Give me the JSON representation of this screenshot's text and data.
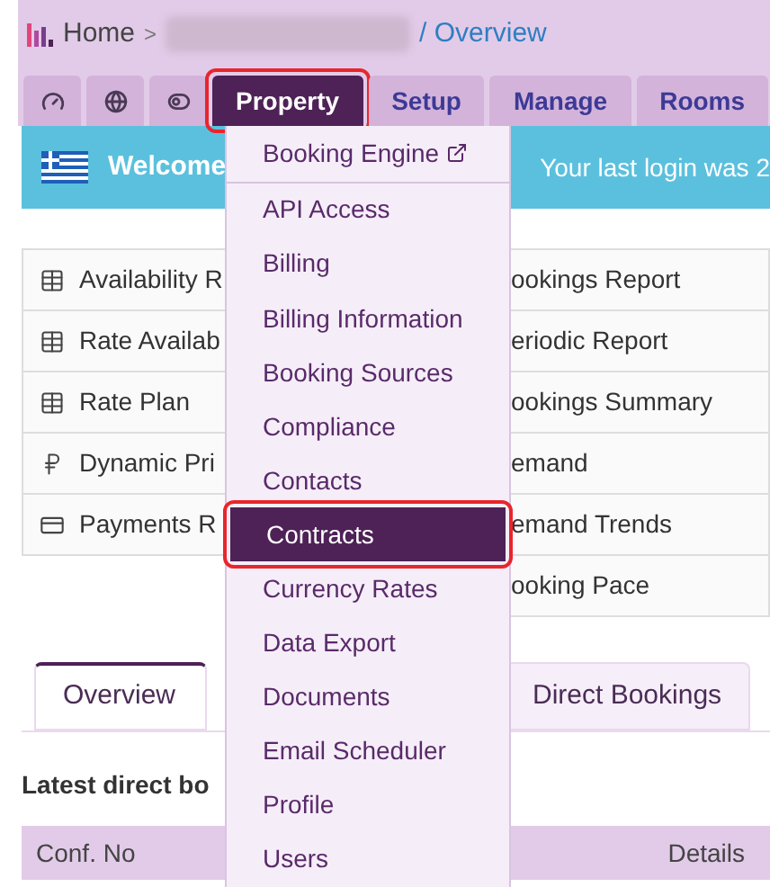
{
  "breadcrumb": {
    "home": "Home",
    "separator": ">",
    "current": "/ Overview"
  },
  "nav_tabs": [
    {
      "kind": "gauge",
      "selected": false,
      "highlighted": false
    },
    {
      "kind": "globe",
      "selected": false,
      "highlighted": false
    },
    {
      "kind": "toggle",
      "selected": false,
      "highlighted": false
    },
    {
      "kind": "text",
      "label": "Property",
      "selected": true,
      "highlighted": true
    },
    {
      "kind": "text",
      "label": "Setup",
      "selected": false,
      "highlighted": false
    },
    {
      "kind": "text",
      "label": "Manage",
      "selected": false,
      "highlighted": false
    },
    {
      "kind": "text",
      "label": "Rooms",
      "selected": false,
      "highlighted": false
    }
  ],
  "banner": {
    "greeting": "Welcome",
    "last_login": "Your last login was 2"
  },
  "menu": [
    {
      "label": "Booking Engine",
      "external": true,
      "selected": false,
      "highlighted": false
    },
    {
      "label": "API Access",
      "external": false,
      "selected": false,
      "highlighted": false
    },
    {
      "label": "Billing",
      "external": false,
      "selected": false,
      "highlighted": false
    },
    {
      "label": "Billing Information",
      "external": false,
      "selected": false,
      "highlighted": false
    },
    {
      "label": "Booking Sources",
      "external": false,
      "selected": false,
      "highlighted": false
    },
    {
      "label": "Compliance",
      "external": false,
      "selected": false,
      "highlighted": false
    },
    {
      "label": "Contacts",
      "external": false,
      "selected": false,
      "highlighted": false
    },
    {
      "label": "Contracts",
      "external": false,
      "selected": true,
      "highlighted": true
    },
    {
      "label": "Currency Rates",
      "external": false,
      "selected": false,
      "highlighted": false
    },
    {
      "label": "Data Export",
      "external": false,
      "selected": false,
      "highlighted": false
    },
    {
      "label": "Documents",
      "external": false,
      "selected": false,
      "highlighted": false
    },
    {
      "label": "Email Scheduler",
      "external": false,
      "selected": false,
      "highlighted": false
    },
    {
      "label": "Profile",
      "external": false,
      "selected": false,
      "highlighted": false
    },
    {
      "label": "Users",
      "external": false,
      "selected": false,
      "highlighted": false
    }
  ],
  "links_left": [
    {
      "label": "Availability R",
      "kind": "grid"
    },
    {
      "label": "Rate Availab",
      "kind": "grid"
    },
    {
      "label": "Rate Plan",
      "kind": "grid"
    },
    {
      "label": "Dynamic Pri",
      "kind": "ruble"
    },
    {
      "label": "Payments R",
      "kind": "card"
    }
  ],
  "links_right": [
    "ookings Report",
    "eriodic Report",
    "ookings Summary",
    "emand",
    "emand Trends",
    "ooking Pace"
  ],
  "content_tabs": [
    {
      "label": "Overview",
      "selected": true
    },
    {
      "label": "Direct Bookings",
      "selected": false
    }
  ],
  "section_title": "Latest direct bo",
  "table": {
    "columns": [
      "Conf. No",
      "Details"
    ]
  }
}
